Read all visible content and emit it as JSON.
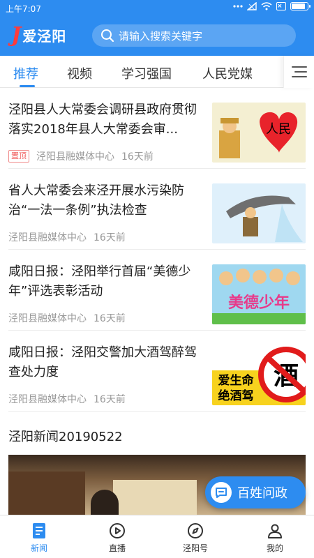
{
  "status_bar": {
    "time": "上午7:07"
  },
  "header": {
    "logo_text": "爱泾阳",
    "search_placeholder": "请输入搜索关键字"
  },
  "tabs": [
    {
      "label": "推荐",
      "active": true
    },
    {
      "label": "视频"
    },
    {
      "label": "学习强国"
    },
    {
      "label": "人民党媒"
    }
  ],
  "news": [
    {
      "title": "泾阳县人大常委会调研县政府贯彻落实2018年县人大常委会审...",
      "pinned_label": "置顶",
      "source": "泾阳县融媒体中心",
      "date": "16天前",
      "thumb_text": "人民"
    },
    {
      "title": "省人大常委会来泾开展水污染防治“一法一条例”执法检查",
      "source": "泾阳县融媒体中心",
      "date": "16天前"
    },
    {
      "title": "咸阳日报：泾阳举行首届“美德少年”评选表彰活动",
      "source": "泾阳县融媒体中心",
      "date": "16天前",
      "thumb_text": "美德少年"
    },
    {
      "title": "咸阳日报：泾阳交警加大酒驾醉驾查处力度",
      "source": "泾阳县融媒体中心",
      "date": "16天前",
      "thumb_line1": "爱生命",
      "thumb_line2": "绝酒驾",
      "thumb_sign": "酒"
    }
  ],
  "video": {
    "title": "泾阳新闻20190522"
  },
  "fab": {
    "label": "百姓问政"
  },
  "bottom_nav": [
    {
      "label": "新闻",
      "icon": "news-icon",
      "active": true
    },
    {
      "label": "直播",
      "icon": "play-icon"
    },
    {
      "label": "泾阳号",
      "icon": "compass-icon"
    },
    {
      "label": "我的",
      "icon": "user-icon"
    }
  ],
  "colors": {
    "primary": "#2d8cf0",
    "pin": "#f05a5a"
  }
}
